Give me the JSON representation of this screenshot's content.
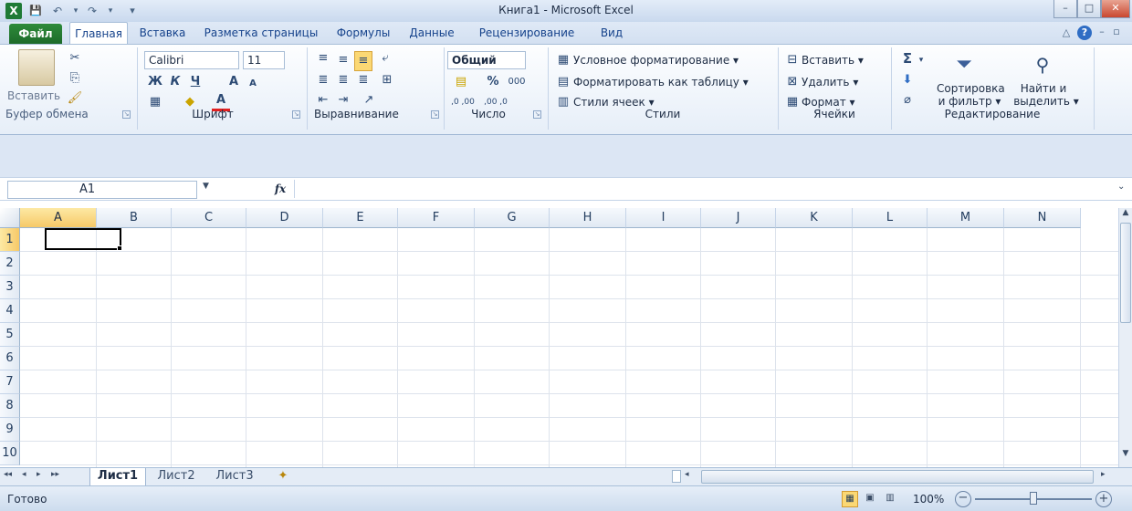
{
  "titlebar": {
    "title": "Книга1  -  Microsoft Excel",
    "min_icon": "–",
    "max_icon": "□",
    "close_icon": "✕"
  },
  "quick_access": {
    "app_icon": "X",
    "save_icon": "💾",
    "undo_icon": "↶",
    "redo_icon": "↷",
    "extra_icon": "▾"
  },
  "tabs": {
    "file": "Файл",
    "home": "Главная",
    "insert": "Вставка",
    "page_layout": "Разметка страницы",
    "formulas": "Формулы",
    "data": "Данные",
    "review": "Рецензирование",
    "view": "Вид"
  },
  "ribbon": {
    "clipboard": {
      "label": "Буфер обмена",
      "paste": "Вставить"
    },
    "font": {
      "label": "Шрифт",
      "font_name": "Calibri",
      "font_size": "11",
      "bold": "Ж",
      "italic": "К",
      "underline": "Ч",
      "grow": "A",
      "shrink": "A",
      "font_color": "A"
    },
    "alignment": {
      "label": "Выравнивание"
    },
    "number": {
      "label": "Число",
      "format": "Общий",
      "percent": "%",
      "thousands": "000",
      "inc_decimal": ",0 ,00",
      "dec_decimal": ",00 ,0"
    },
    "styles": {
      "label": "Стили",
      "conditional": "Условное форматирование",
      "format_table": "Форматировать как таблицу",
      "cell_styles": "Стили ячеек"
    },
    "cells": {
      "label": "Ячейки",
      "insert": "Вставить",
      "delete": "Удалить",
      "format": "Формат"
    },
    "editing": {
      "label": "Редактирование",
      "sum": "Σ",
      "sort_line1": "Сортировка",
      "sort_line2": "и фильтр",
      "find_line1": "Найти и",
      "find_line2": "выделить"
    }
  },
  "formula_bar": {
    "name_box": "A1",
    "fx": "fx",
    "formula": ""
  },
  "grid": {
    "columns": [
      "A",
      "B",
      "C",
      "D",
      "E",
      "F",
      "G",
      "H",
      "I",
      "J",
      "K",
      "L",
      "M",
      "N"
    ],
    "rows": [
      "1",
      "2",
      "3",
      "4",
      "5",
      "6",
      "7",
      "8",
      "9",
      "10"
    ],
    "selected_cell": "A1"
  },
  "sheets": {
    "tabs": [
      "Лист1",
      "Лист2",
      "Лист3"
    ],
    "active": "Лист1",
    "nav_first": "◂◂",
    "nav_prev": "◂",
    "nav_next": "▸",
    "nav_last": "▸▸"
  },
  "status": {
    "ready": "Готово",
    "zoom": "100%",
    "zoom_minus": "−",
    "zoom_plus": "+"
  },
  "colors": {
    "file_tab": "#2e8b3a",
    "selection": "#000000",
    "header_selected": "#f6c968"
  }
}
